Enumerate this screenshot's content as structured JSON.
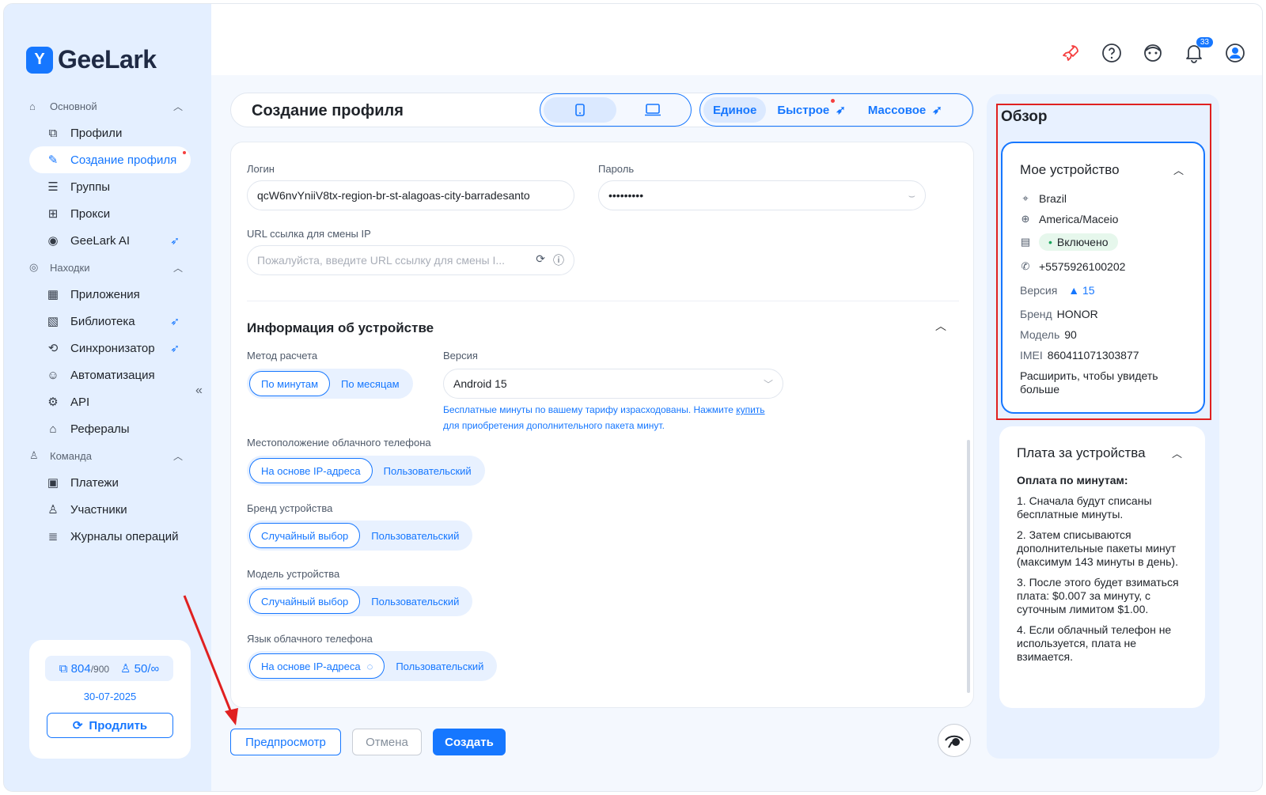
{
  "app": {
    "name": "GeeLark",
    "logo_letter": "Y"
  },
  "sidebar": {
    "sections": [
      {
        "label": "Основной",
        "items": [
          {
            "label": "Профили",
            "icon": "profiles-icon",
            "glyph": "⧉"
          },
          {
            "label": "Создание профиля",
            "icon": "edit-icon",
            "glyph": "✎",
            "active": true,
            "dot": true
          },
          {
            "label": "Группы",
            "icon": "list-icon",
            "glyph": "☰"
          },
          {
            "label": "Прокси",
            "icon": "proxy-icon",
            "glyph": "⊞"
          },
          {
            "label": "GeeLark AI",
            "icon": "ai-eye-icon",
            "glyph": "◉",
            "bird": true
          }
        ]
      },
      {
        "label": "Находки",
        "items": [
          {
            "label": "Приложения",
            "icon": "apps-icon",
            "glyph": "▦"
          },
          {
            "label": "Библиотека",
            "icon": "library-icon",
            "glyph": "▧",
            "bird": true
          },
          {
            "label": "Синхронизатор",
            "icon": "sync-icon",
            "glyph": "⟲",
            "bird": true
          },
          {
            "label": "Автоматизация",
            "icon": "robot-icon",
            "glyph": "☺"
          },
          {
            "label": "API",
            "icon": "api-icon",
            "glyph": "⚙"
          },
          {
            "label": "Рефералы",
            "icon": "gift-icon",
            "glyph": "⌂"
          }
        ]
      },
      {
        "label": "Команда",
        "items": [
          {
            "label": "Платежи",
            "icon": "wallet-icon",
            "glyph": "▣"
          },
          {
            "label": "Участники",
            "icon": "user-icon",
            "glyph": "♙"
          },
          {
            "label": "Журналы операций",
            "icon": "log-icon",
            "glyph": "≣"
          }
        ]
      }
    ],
    "collapse_glyph": "«",
    "plan": {
      "profiles_used": "804",
      "profiles_total": "/900",
      "members": "50/",
      "members_limit": "∞",
      "date": "30-07-2025",
      "renew_label": "Продлить"
    }
  },
  "topbar": {
    "notifications_count": "33"
  },
  "header": {
    "title": "Создание профиля",
    "modes": [
      "Единое",
      "Быстрое",
      "Массовое"
    ]
  },
  "form": {
    "login_label": "Логин",
    "login_value": "qcW6nvYniiV8tx-region-br-st-alagoas-city-barradesanto",
    "password_label": "Пароль",
    "password_value": "•••••••••",
    "url_label": "URL ссылка для смены IP",
    "url_placeholder": "Пожалуйста, введите URL ссылку для смены I...",
    "device_section_title": "Информация об устройстве",
    "billing_label": "Метод расчета",
    "billing_options": [
      "По минутам",
      "По месяцам"
    ],
    "version_label": "Версия",
    "version_value": "Android 15",
    "note_part1": "Бесплатные минуты по вашему тарифу израсходованы. Нажмите",
    "note_link": "купить",
    "note_part2": "для приобретения дополнительного пакета минут.",
    "location_label": "Местоположение облачного телефона",
    "location_options": [
      "На основе IP-адреса",
      "Пользовательский"
    ],
    "brand_label": "Бренд устройства",
    "brand_options": [
      "Случайный выбор",
      "Пользовательский"
    ],
    "model_label": "Модель устройства",
    "model_options": [
      "Случайный выбор",
      "Пользовательский"
    ],
    "language_label": "Язык облачного телефона",
    "language_options": [
      "На основе IP-адреса",
      "Пользовательский"
    ]
  },
  "footer": {
    "preview_label": "Предпросмотр",
    "cancel_label": "Отмена",
    "create_label": "Создать"
  },
  "overview": {
    "title": "Обзор",
    "device_card": {
      "title": "Мое устройство",
      "country": "Brazil",
      "timezone": "America/Maceio",
      "status": "Включено",
      "phone": "+5575926100202",
      "version_key": "Версия",
      "version_value": "15",
      "brand_key": "Бренд",
      "brand_value": "HONOR",
      "model_key": "Модель",
      "model_value": "90",
      "imei_key": "IMEI",
      "imei_value": "860411071303877",
      "expand_text": "Расширить, чтобы увидеть больше"
    },
    "fee_card": {
      "title": "Плата за устройства",
      "heading": "Оплата по минутам:",
      "items": [
        "1. Сначала будут списаны бесплатные минуты.",
        "2. Затем списываются дополнительные пакеты минут (максимум 143 минуты в день).",
        "3. После этого будет взиматься плата: $0.007 за минуту, с суточным лимитом $1.00.",
        "4. Если облачный телефон не используется, плата не взимается."
      ]
    }
  },
  "colors": {
    "accent": "#1677ff",
    "highlight": "#e02020",
    "status_green": "#19a55b"
  }
}
